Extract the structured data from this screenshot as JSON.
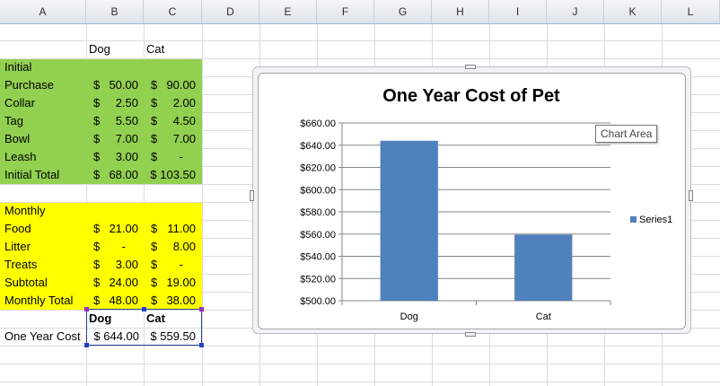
{
  "columns": [
    "A",
    "B",
    "C",
    "D",
    "E",
    "F",
    "G",
    "H",
    "I",
    "J",
    "K",
    "L"
  ],
  "table": {
    "header_dog": "Dog",
    "header_cat": "Cat",
    "initial_label": "Initial",
    "initial_rows": [
      {
        "label": "Purchase",
        "dog": "50.00",
        "cat": "90.00"
      },
      {
        "label": "Collar",
        "dog": "2.50",
        "cat": "2.00"
      },
      {
        "label": "Tag",
        "dog": "5.50",
        "cat": "4.50"
      },
      {
        "label": "Bowl",
        "dog": "7.00",
        "cat": "7.00"
      },
      {
        "label": "Leash",
        "dog": "3.00",
        "cat": "-"
      }
    ],
    "initial_total": {
      "label": "Initial Total",
      "dog": "68.00",
      "cat": "$ 103.50"
    },
    "monthly_label": "Monthly",
    "monthly_rows": [
      {
        "label": "Food",
        "dog": "21.00",
        "cat": "11.00"
      },
      {
        "label": "Litter",
        "dog": "-",
        "cat": "8.00"
      },
      {
        "label": "Treats",
        "dog": "3.00",
        "cat": "-"
      },
      {
        "label": "Subtotal",
        "dog": "24.00",
        "cat": "19.00"
      }
    ],
    "monthly_total": {
      "label": "Monthly Total",
      "dog": "48.00",
      "cat": "38.00"
    },
    "currency": "$",
    "summary_header_dog": "Dog",
    "summary_header_cat": "Cat",
    "one_year": {
      "label": "One Year Cost",
      "dog": "$ 644.00",
      "cat": "$ 559.50"
    }
  },
  "colors": {
    "initial_fill": "#92d050",
    "monthly_fill": "#ffff00",
    "bar": "#4f81bd",
    "selection": "#2a3f9a"
  },
  "chart_tooltip": "Chart Area",
  "chart_data": {
    "type": "bar",
    "title": "One Year Cost of Pet",
    "categories": [
      "Dog",
      "Cat"
    ],
    "series": [
      {
        "name": "Series1",
        "values": [
          644.0,
          559.5
        ]
      }
    ],
    "ylim": [
      500,
      660
    ],
    "ytick_step": 20,
    "ytick_labels": [
      "$500.00",
      "$520.00",
      "$540.00",
      "$560.00",
      "$580.00",
      "$600.00",
      "$620.00",
      "$640.00",
      "$660.00"
    ],
    "grid": true,
    "legend": "right",
    "xlabel": "",
    "ylabel": ""
  }
}
